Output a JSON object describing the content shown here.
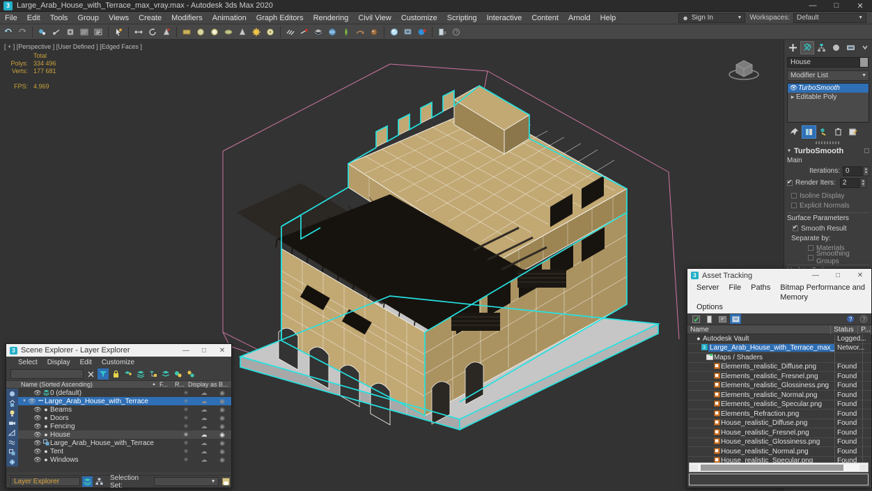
{
  "titlebar": {
    "app_icon": "max-app-icon",
    "title": "Large_Arab_House_with_Terrace_max_vray.max - Autodesk 3ds Max 2020",
    "minimize": "—",
    "maximize": "□",
    "close": "✕"
  },
  "menubar": {
    "items": [
      {
        "label": "File"
      },
      {
        "label": "Edit"
      },
      {
        "label": "Tools"
      },
      {
        "label": "Group"
      },
      {
        "label": "Views"
      },
      {
        "label": "Create"
      },
      {
        "label": "Modifiers"
      },
      {
        "label": "Animation"
      },
      {
        "label": "Graph Editors"
      },
      {
        "label": "Rendering"
      },
      {
        "label": "Civil View"
      },
      {
        "label": "Customize"
      },
      {
        "label": "Scripting"
      },
      {
        "label": "Interactive"
      },
      {
        "label": "Content"
      },
      {
        "label": "Arnold"
      },
      {
        "label": "Help"
      }
    ],
    "sign_in": "Sign In",
    "workspaces_label": "Workspaces:",
    "workspace_value": "Default"
  },
  "viewport": {
    "label": "[ + ] [Perspective ] [User Defined ] [Edged Faces ]",
    "stats": {
      "total_header": "Total",
      "polys_label": "Polys:",
      "polys_value": "334 496",
      "verts_label": "Verts:",
      "verts_value": "177 681",
      "fps_label": "FPS:",
      "fps_value": "4.969"
    },
    "colors": {
      "background": "#333333",
      "wall": "#c2a873",
      "wall_shade": "#9c8553",
      "wireframe": "#f2f0e8",
      "selection": "#25e1e1",
      "gizmo_pink": "#d77aa8",
      "tent_dark": "#1a1714",
      "ground": "#c8c8c8"
    },
    "viewcube": "viewcube-icon"
  },
  "command_panel": {
    "tabs": [
      "create-tab",
      "modify-tab",
      "hierarchy-tab",
      "motion-tab",
      "display-tab",
      "utilities-tab"
    ],
    "selected_tab": "modify-tab",
    "object_name": "House",
    "modifier_list_label": "Modifier List",
    "stack": [
      {
        "name": "TurboSmooth",
        "selected": true,
        "has_eye": true
      },
      {
        "name": "Editable Poly",
        "selected": false,
        "has_eye": false
      }
    ],
    "stack_tools": [
      "pin-stack-icon",
      "show-end-result-icon",
      "make-unique-icon",
      "remove-modifier-icon",
      "configure-sets-icon"
    ],
    "rollout": {
      "title": "TurboSmooth",
      "main_label": "Main",
      "iterations_label": "Iterations:",
      "iterations_value": "0",
      "render_iters_label": "Render Iters:",
      "render_iters_value": "2",
      "render_iters_checked": true,
      "isoline_display": "Isoline Display",
      "isoline_checked": false,
      "explicit_normals": "Explicit Normals",
      "explicit_checked": false,
      "surface_parameters": "Surface Parameters",
      "smooth_result": "Smooth Result",
      "smooth_result_checked": true,
      "separate_by": "Separate by:",
      "materials": "Materials",
      "materials_checked": false,
      "smoothing_groups": "Smoothing Groups",
      "smoothing_groups_checked": false,
      "update_options": "Update Options"
    }
  },
  "scene_explorer": {
    "title": "Scene Explorer - Layer Explorer",
    "icon": "max-app-icon",
    "minimize": "—",
    "maximize": "□",
    "close": "✕",
    "menu": [
      "Select",
      "Display",
      "Edit",
      "Customize"
    ],
    "search_value": "",
    "toolbar": [
      "clear-search-icon",
      "filter-icon",
      "lock-icon",
      "add-layer-icon",
      "layers-icon",
      "nest-icon",
      "set-layer-icon",
      "hide-icon",
      "freeze-icon"
    ],
    "columns": {
      "name": "Name (Sorted Ascending)",
      "sort_arrow": "▲",
      "frozen": "F...",
      "renderable": "R...",
      "display_as": "Display as B..."
    },
    "rows": [
      {
        "name": "0 (default)",
        "indent": 1,
        "type": "layer",
        "state": "normal",
        "expander": ""
      },
      {
        "name": "Large_Arab_House_with_Terrace",
        "indent": 1,
        "type": "layer",
        "state": "selected",
        "expander": "▼"
      },
      {
        "name": "Beams",
        "indent": 2,
        "type": "object",
        "state": "normal",
        "expander": ""
      },
      {
        "name": "Doors",
        "indent": 2,
        "type": "object",
        "state": "normal",
        "expander": ""
      },
      {
        "name": "Fencing",
        "indent": 2,
        "type": "object",
        "state": "normal",
        "expander": ""
      },
      {
        "name": "House",
        "indent": 2,
        "type": "object",
        "state": "highlighted",
        "expander": ""
      },
      {
        "name": "Large_Arab_House_with_Terrace",
        "indent": 2,
        "type": "group",
        "state": "normal",
        "expander": ""
      },
      {
        "name": "Tent",
        "indent": 2,
        "type": "object",
        "state": "normal",
        "expander": ""
      },
      {
        "name": "Windows",
        "indent": 2,
        "type": "object",
        "state": "normal",
        "expander": ""
      }
    ],
    "status": {
      "explorer_name": "Layer Explorer",
      "selection_set_label": "Selection Set:",
      "selection_set_value": ""
    }
  },
  "asset_tracking": {
    "title": "Asset Tracking",
    "icon": "max-app-icon",
    "minimize": "—",
    "maximize": "□",
    "close": "✕",
    "menu_row1": [
      "Server",
      "File",
      "Paths",
      "Bitmap Performance and Memory"
    ],
    "menu_row2": [
      "Options"
    ],
    "toolbar": [
      "check-in-icon",
      "check-out-icon",
      "get-latest-icon",
      "refresh-icon"
    ],
    "help_icons": [
      "help-icon",
      "info-icon"
    ],
    "columns": {
      "name": "Name",
      "status": "Status",
      "path": "P..."
    },
    "rows": [
      {
        "name": "Autodesk Vault",
        "status": "Logged...",
        "indent": 1,
        "icon": "vault-icon",
        "selected": false
      },
      {
        "name": "Large_Arab_House_with_Terrace_max_vray.max",
        "status": "Networ...",
        "indent": 2,
        "icon": "max-file-icon",
        "selected": true
      },
      {
        "name": "Maps / Shaders",
        "status": "",
        "indent": 3,
        "icon": "folder-icon",
        "selected": false
      },
      {
        "name": "Elements_realistic_Diffuse.png",
        "status": "Found",
        "indent": 4,
        "icon": "png-icon",
        "selected": false
      },
      {
        "name": "Elements_realistic_Fresnel.png",
        "status": "Found",
        "indent": 4,
        "icon": "png-icon",
        "selected": false
      },
      {
        "name": "Elements_realistic_Glossiness.png",
        "status": "Found",
        "indent": 4,
        "icon": "png-icon",
        "selected": false
      },
      {
        "name": "Elements_realistic_Normal.png",
        "status": "Found",
        "indent": 4,
        "icon": "png-icon",
        "selected": false
      },
      {
        "name": "Elements_realistic_Specular.png",
        "status": "Found",
        "indent": 4,
        "icon": "png-icon",
        "selected": false
      },
      {
        "name": "Elements_Refraction.png",
        "status": "Found",
        "indent": 4,
        "icon": "png-icon",
        "selected": false
      },
      {
        "name": "House_realistic_Diffuse.png",
        "status": "Found",
        "indent": 4,
        "icon": "png-icon",
        "selected": false
      },
      {
        "name": "House_realistic_Fresnel.png",
        "status": "Found",
        "indent": 4,
        "icon": "png-icon",
        "selected": false
      },
      {
        "name": "House_realistic_Glossiness.png",
        "status": "Found",
        "indent": 4,
        "icon": "png-icon",
        "selected": false
      },
      {
        "name": "House_realistic_Normal.png",
        "status": "Found",
        "indent": 4,
        "icon": "png-icon",
        "selected": false
      },
      {
        "name": "House_realistic_Specular.png",
        "status": "Found",
        "indent": 4,
        "icon": "png-icon",
        "selected": false
      }
    ]
  },
  "main_toolbar": {
    "groups": [
      [
        "undo-icon",
        "redo-icon",
        "select-link-icon",
        "unlink-icon",
        "bind-space-warp-icon"
      ],
      [
        "select-object-icon",
        "select-by-name-icon",
        "select-region-icon"
      ],
      [
        "select-move-icon",
        "select-rotate-icon",
        "select-scale-icon"
      ],
      [
        "reference-coord-icon",
        "use-pivot-icon",
        "snap-toggle-icon",
        "angle-snap-icon",
        "percent-snap-icon"
      ],
      [
        "named-selection-icon",
        "mirror-icon",
        "align-icon"
      ],
      [
        "layer-manager-icon",
        "curve-editor-icon",
        "schematic-view-icon"
      ],
      [
        "material-editor-icon",
        "render-setup-icon",
        "render-frame-icon",
        "render-production-icon"
      ],
      [
        "render-in-cloud-icon",
        "open-asset-tracking-icon"
      ]
    ]
  }
}
